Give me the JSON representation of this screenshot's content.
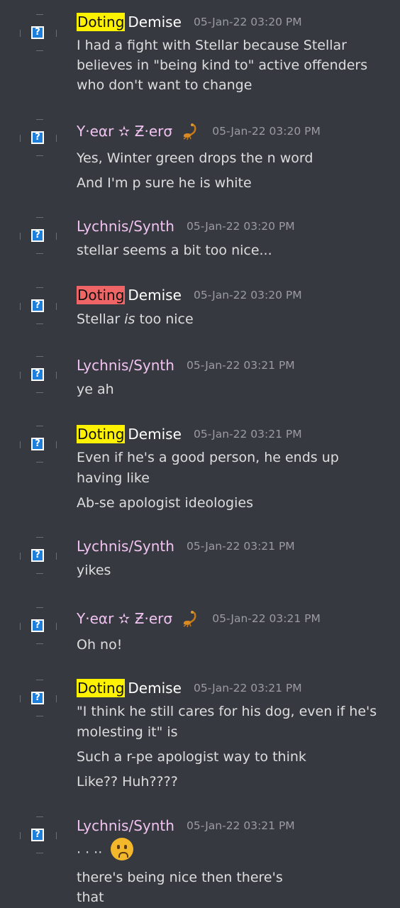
{
  "messages": [
    {
      "author_hl": "Doting",
      "author_rest": "Demise",
      "hl_color": "yellow",
      "time": "05-Jan-22 03:20 PM",
      "lines": [
        "I had a fight with Stellar because Stellar",
        "believes in \"being kind to\" active offenders",
        "who don't want to change"
      ]
    },
    {
      "author": "Y·eαr ✫ Ƶ·erσ",
      "has_scorpion": true,
      "time": "05-Jan-22 03:20 PM",
      "lines": [
        "Yes, Winter green drops the n word",
        "And I'm p sure he is white"
      ]
    },
    {
      "author": "Lychnis/Synth",
      "time": "05-Jan-22 03:20 PM",
      "lines": [
        "stellar seems a bit too nice..."
      ]
    },
    {
      "author_hl": "Doting",
      "author_rest": "Demise",
      "hl_color": "red",
      "time": "05-Jan-22 03:20 PM",
      "lines": [
        "Stellar",
        "is",
        "too nice"
      ]
    },
    {
      "author": "Lychnis/Synth",
      "time": "05-Jan-22 03:21 PM",
      "lines": [
        "ye ah"
      ]
    },
    {
      "author_hl": "Doting",
      "author_rest": "Demise",
      "hl_color": "yellow",
      "time": "05-Jan-22 03:21 PM",
      "lines": [
        "Even if he's a good person, he ends up",
        "having like",
        "Ab-se apologist ideologies"
      ]
    },
    {
      "author": "Lychnis/Synth",
      "time": "05-Jan-22 03:21 PM",
      "lines": [
        "yikes"
      ]
    },
    {
      "author": "Y·eαr ✫ Ƶ·erσ",
      "has_scorpion": true,
      "time": "05-Jan-22 03:21 PM",
      "lines": [
        "Oh no!"
      ]
    },
    {
      "author_hl": "Doting",
      "author_rest": "Demise",
      "hl_color": "yellow",
      "time": "05-Jan-22 03:21 PM",
      "lines": [
        "\"I think he still cares for his dog, even if he's",
        "molesting it\" is",
        "Such a r-pe apologist way to think",
        "Like?? Huh????"
      ]
    },
    {
      "author": "Lychnis/Synth",
      "time": "05-Jan-22 03:21 PM",
      "lines": [
        ". . ..",
        "there's being nice then there's",
        "that"
      ],
      "emoji": "worried-face"
    }
  ],
  "avatar_glyph": "?",
  "colors": {
    "background": "#36393f",
    "highlight_yellow": "#fff200",
    "highlight_red": "#f06565",
    "name_pink": "#f0c2f0",
    "timestamp": "#9a9ca2"
  }
}
